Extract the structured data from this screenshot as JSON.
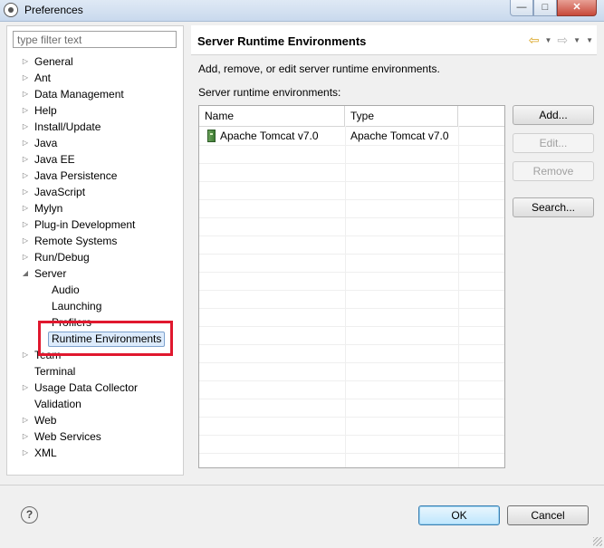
{
  "window": {
    "title": "Preferences",
    "minimize_glyph": "—",
    "maximize_glyph": "□",
    "close_glyph": "✕"
  },
  "filter": {
    "placeholder": "type filter text"
  },
  "tree": {
    "items": [
      {
        "label": "General",
        "twisty": "▷"
      },
      {
        "label": "Ant",
        "twisty": "▷"
      },
      {
        "label": "Data Management",
        "twisty": "▷"
      },
      {
        "label": "Help",
        "twisty": "▷"
      },
      {
        "label": "Install/Update",
        "twisty": "▷"
      },
      {
        "label": "Java",
        "twisty": "▷"
      },
      {
        "label": "Java EE",
        "twisty": "▷"
      },
      {
        "label": "Java Persistence",
        "twisty": "▷"
      },
      {
        "label": "JavaScript",
        "twisty": "▷"
      },
      {
        "label": "Mylyn",
        "twisty": "▷"
      },
      {
        "label": "Plug-in Development",
        "twisty": "▷"
      },
      {
        "label": "Remote Systems",
        "twisty": "▷"
      },
      {
        "label": "Run/Debug",
        "twisty": "▷"
      },
      {
        "label": "Server",
        "twisty": "◢"
      },
      {
        "label": "Audio"
      },
      {
        "label": "Launching"
      },
      {
        "label": "Profilers"
      },
      {
        "label": "Runtime Environments"
      },
      {
        "label": "Team",
        "twisty": "▷"
      },
      {
        "label": "Terminal"
      },
      {
        "label": "Usage Data Collector",
        "twisty": "▷"
      },
      {
        "label": "Validation"
      },
      {
        "label": "Web",
        "twisty": "▷"
      },
      {
        "label": "Web Services",
        "twisty": "▷"
      },
      {
        "label": "XML",
        "twisty": "▷"
      }
    ]
  },
  "page": {
    "title": "Server Runtime Environments",
    "description": "Add, remove, or edit server runtime environments.",
    "section_label": "Server runtime environments:",
    "nav": {
      "back_glyph": "⇦",
      "forward_glyph": "⇨",
      "dropdown_glyph": "▼"
    }
  },
  "table": {
    "columns": [
      "Name",
      "Type"
    ],
    "rows": [
      {
        "name": "Apache Tomcat v7.0",
        "type": "Apache Tomcat v7.0"
      }
    ]
  },
  "buttons": {
    "add": "Add...",
    "edit": "Edit...",
    "remove": "Remove",
    "search": "Search..."
  },
  "dialog": {
    "help_glyph": "?",
    "ok": "OK",
    "cancel": "Cancel"
  }
}
